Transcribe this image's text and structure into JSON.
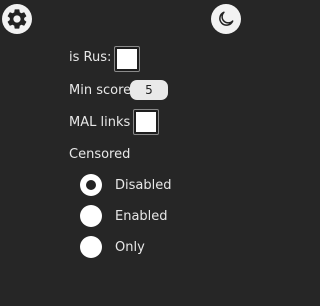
{
  "toolbar": {
    "settings_icon": "gear-icon",
    "theme_icon": "crescent-moon-icon"
  },
  "options": {
    "is_rus": {
      "label": "is Rus:",
      "checked": false
    },
    "min_score": {
      "label": "Min score:",
      "value": "5"
    },
    "mal_links": {
      "label": "MAL links",
      "checked": false
    }
  },
  "censored": {
    "heading": "Censored",
    "options": [
      {
        "label": "Disabled",
        "selected": true
      },
      {
        "label": "Enabled",
        "selected": false
      },
      {
        "label": "Only",
        "selected": false
      }
    ]
  },
  "colors": {
    "background": "#262626",
    "text": "#e6e6e6",
    "control": "#ffffff"
  }
}
